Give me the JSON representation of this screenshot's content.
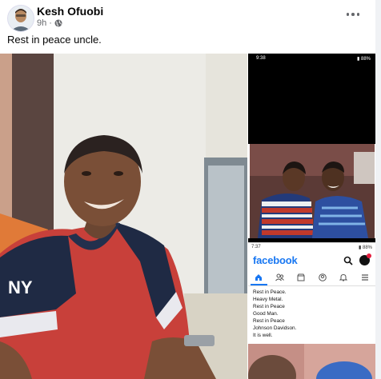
{
  "post": {
    "author": "Kesh Ofuobi",
    "time": "9h",
    "privacy_icon": "globe-icon",
    "text": "Rest in peace uncle.",
    "more_icon": "more-options-icon"
  },
  "screenshot": {
    "status_top": {
      "time": "9:38",
      "right": "▮ 88%"
    },
    "status_bottom": {
      "time": "7:37",
      "right": "▮ 88%"
    },
    "app_name": "facebook",
    "nav_icons": [
      "home-icon",
      "friends-icon",
      "marketplace-icon",
      "profile-icon",
      "notifications-icon",
      "menu-icon"
    ],
    "tributes": [
      "Rest in Peace.",
      "Heavy Metal.",
      "Rest in Peace",
      "Good Man.",
      "Rest in Peace",
      "Johnson Davidson.",
      "It is well."
    ]
  },
  "colors": {
    "facebook_blue": "#1877f2",
    "badge_red": "#e41e3f",
    "meta_gray": "#65676b"
  }
}
